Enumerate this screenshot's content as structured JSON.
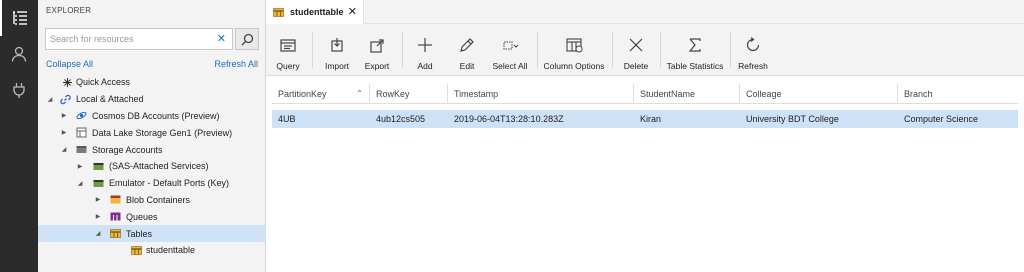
{
  "activity_bar": {
    "icons": [
      "explorer-icon",
      "account-icon",
      "plug-icon"
    ]
  },
  "explorer": {
    "title": "EXPLORER",
    "search": {
      "placeholder": "Search for resources",
      "value": ""
    },
    "collapse_all": "Collapse All",
    "refresh_all": "Refresh All",
    "tree": [
      {
        "label": "Quick Access",
        "icon": "quick-access-icon"
      },
      {
        "label": "Local & Attached",
        "icon": "link-icon"
      },
      {
        "label": "Cosmos DB Accounts (Preview)",
        "icon": "cosmos-db-icon"
      },
      {
        "label": "Data Lake Storage Gen1 (Preview)",
        "icon": "data-lake-icon"
      },
      {
        "label": "Storage Accounts",
        "icon": "storage-accounts-icon"
      },
      {
        "label": "(SAS-Attached Services)",
        "icon": "storage-account-icon"
      },
      {
        "label": "Emulator - Default Ports (Key)",
        "icon": "storage-account-icon"
      },
      {
        "label": "Blob Containers",
        "icon": "blob-containers-icon"
      },
      {
        "label": "Queues",
        "icon": "queues-icon"
      },
      {
        "label": "Tables",
        "icon": "tables-icon"
      },
      {
        "label": "studenttable",
        "icon": "table-icon"
      }
    ]
  },
  "tab": {
    "label": "studenttable"
  },
  "toolbar": {
    "buttons": [
      {
        "label": "Query",
        "icon": "query-icon"
      },
      {
        "label": "Import",
        "icon": "import-icon"
      },
      {
        "label": "Export",
        "icon": "export-icon"
      },
      {
        "label": "Add",
        "icon": "add-icon"
      },
      {
        "label": "Edit",
        "icon": "edit-icon"
      },
      {
        "label": "Select All",
        "icon": "select-all-icon"
      },
      {
        "label": "Column Options",
        "icon": "column-options-icon"
      },
      {
        "label": "Delete",
        "icon": "delete-icon"
      },
      {
        "label": "Table Statistics",
        "icon": "sigma-icon"
      },
      {
        "label": "Refresh",
        "icon": "refresh-icon"
      }
    ]
  },
  "table": {
    "columns": [
      "PartitionKey",
      "RowKey",
      "Timestamp",
      "StudentName",
      "Colleage",
      "Branch"
    ],
    "sorted_column": "PartitionKey",
    "rows": [
      [
        "4UB",
        "4ub12cs505",
        "2019-06-04T13:28:10.283Z",
        "Kiran",
        "University BDT College",
        "Computer Science"
      ]
    ]
  },
  "colors": {
    "activity_bar": "#2b2b2b",
    "panel_bg": "#f3f3f3",
    "selection": "#cde1f7",
    "link": "#1a6cc0"
  }
}
